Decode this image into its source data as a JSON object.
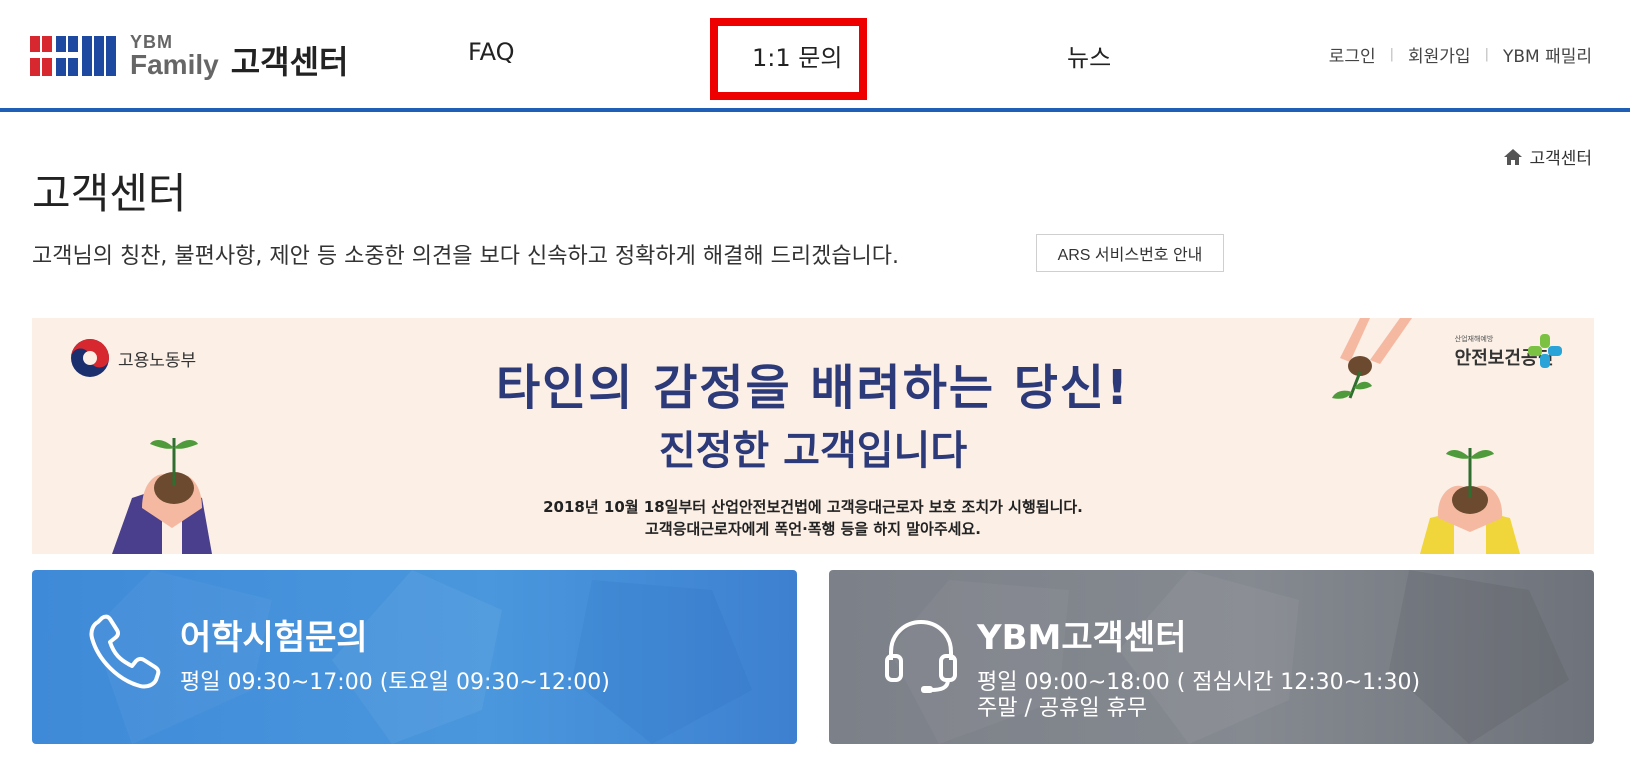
{
  "header": {
    "logo": {
      "brand_top": "YBM",
      "brand_bottom": "Family",
      "title": "고객센터"
    },
    "nav": {
      "faq": "FAQ",
      "inquiry": "1:1 문의",
      "news": "뉴스"
    },
    "util": {
      "login": "로그인",
      "signup": "회원가입",
      "family": "YBM 패밀리"
    },
    "accent_color": "#1f5fb5",
    "highlight_color": "#ee0000"
  },
  "page": {
    "breadcrumb": "고객센터",
    "title": "고객센터",
    "description": "고객님의 칭찬, 불편사항, 제안 등 소중한 의견을 보다 신속하고 정확하게 해결해 드리겠습니다.",
    "ars_button": "ARS 서비스번호 안내"
  },
  "banner": {
    "ministry": "고용노동부",
    "kosha_small": "산업재해예방",
    "kosha": "안전보건공단",
    "headline": "타인의 감정을 배려하는 당신!",
    "sub": "진정한 고객입니다",
    "note1": "2018년 10월 18일부터 산업안전보건법에 고객응대근로자 보호 조치가 시행됩니다.",
    "note2": "고객응대근로자에게 폭언·폭행 등을 하지 말아주세요."
  },
  "cards": [
    {
      "title": "어학시험문의",
      "line1": "평일 09:30~17:00 (토요일 09:30~12:00)",
      "line2": "",
      "icon": "phone-icon",
      "color": "#3f8ad8"
    },
    {
      "title": "YBM고객센터",
      "line1": "평일 09:00~18:00 ( 점심시간 12:30~1:30)",
      "line2": "주말 / 공휴일 휴무",
      "icon": "headset-icon",
      "color": "#7c8088"
    }
  ]
}
